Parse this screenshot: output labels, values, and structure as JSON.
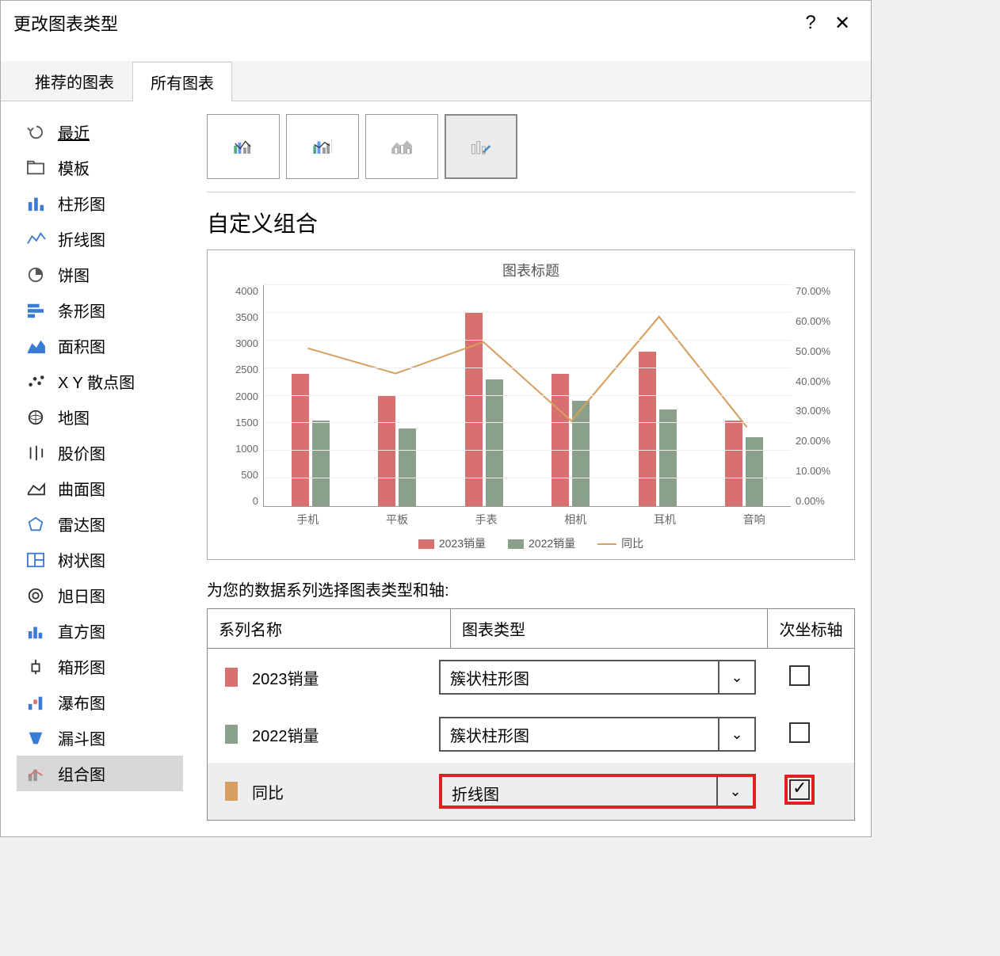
{
  "dialog": {
    "title": "更改图表类型",
    "help_label": "?",
    "close_label": "✕"
  },
  "tabs": {
    "recommended": "推荐的图表",
    "all": "所有图表"
  },
  "sidebar": {
    "items": [
      {
        "label": "最近",
        "icon": "undo"
      },
      {
        "label": "模板",
        "icon": "folder"
      },
      {
        "label": "柱形图",
        "icon": "column"
      },
      {
        "label": "折线图",
        "icon": "line"
      },
      {
        "label": "饼图",
        "icon": "pie"
      },
      {
        "label": "条形图",
        "icon": "bar"
      },
      {
        "label": "面积图",
        "icon": "area"
      },
      {
        "label": "X Y 散点图",
        "icon": "scatter"
      },
      {
        "label": "地图",
        "icon": "map"
      },
      {
        "label": "股价图",
        "icon": "stock"
      },
      {
        "label": "曲面图",
        "icon": "surface"
      },
      {
        "label": "雷达图",
        "icon": "radar"
      },
      {
        "label": "树状图",
        "icon": "treemap"
      },
      {
        "label": "旭日图",
        "icon": "sunburst"
      },
      {
        "label": "直方图",
        "icon": "histogram"
      },
      {
        "label": "箱形图",
        "icon": "box"
      },
      {
        "label": "瀑布图",
        "icon": "waterfall"
      },
      {
        "label": "漏斗图",
        "icon": "funnel"
      },
      {
        "label": "组合图",
        "icon": "combo"
      }
    ]
  },
  "main": {
    "section_title": "自定义组合",
    "preview_title": "图表标题",
    "series_instruction": "为您的数据系列选择图表类型和轴:",
    "header_name": "系列名称",
    "header_type": "图表类型",
    "header_axis": "次坐标轴"
  },
  "series": [
    {
      "name": "2023销量",
      "color": "#d87070",
      "chart_type": "簇状柱形图",
      "secondary": false,
      "highlight": false
    },
    {
      "name": "2022销量",
      "color": "#8aa08a",
      "chart_type": "簇状柱形图",
      "secondary": false,
      "highlight": false
    },
    {
      "name": "同比",
      "color": "#d8a060",
      "chart_type": "折线图",
      "secondary": true,
      "highlight": true
    }
  ],
  "chart_data": {
    "type": "combo",
    "title": "图表标题",
    "categories": [
      "手机",
      "平板",
      "手表",
      "相机",
      "耳机",
      "音响"
    ],
    "y_left": {
      "label": "",
      "min": 0,
      "max": 4000,
      "ticks": [
        0,
        500,
        1000,
        1500,
        2000,
        2500,
        3000,
        3500,
        4000
      ]
    },
    "y_right": {
      "label": "",
      "min": 0,
      "max": 0.7,
      "ticks": [
        "0.00%",
        "10.00%",
        "20.00%",
        "30.00%",
        "40.00%",
        "50.00%",
        "60.00%",
        "70.00%"
      ]
    },
    "series": [
      {
        "name": "2023销量",
        "type": "bar",
        "axis": "left",
        "color": "#d87070",
        "values": [
          2400,
          2000,
          3500,
          2400,
          2800,
          1550
        ]
      },
      {
        "name": "2022销量",
        "type": "bar",
        "axis": "left",
        "color": "#8aa08a",
        "values": [
          1550,
          1400,
          2300,
          1900,
          1750,
          1250
        ]
      },
      {
        "name": "同比",
        "type": "line",
        "axis": "right",
        "color": "#d8a060",
        "values": [
          0.5,
          0.42,
          0.52,
          0.27,
          0.6,
          0.25
        ]
      }
    ],
    "legend": [
      "2023销量",
      "2022销量",
      "同比"
    ]
  }
}
